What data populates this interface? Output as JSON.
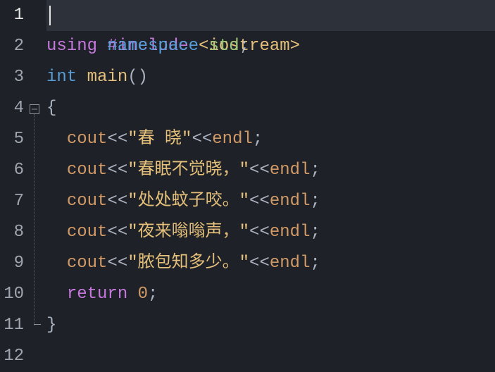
{
  "line_numbers": [
    "1",
    "2",
    "3",
    "4",
    "5",
    "6",
    "7",
    "8",
    "9",
    "10",
    "11",
    "12"
  ],
  "code": {
    "l1": {
      "pp": "#include",
      "sp": " ",
      "inc": "<iostream>"
    },
    "l2": {
      "kw": "using",
      "sp1": " ",
      "kw2": "namespace",
      "sp2": " ",
      "ns": "std",
      "semi": ";"
    },
    "l3": {
      "kw2": "int",
      "sp": " ",
      "fn": "main",
      "paren": "()"
    },
    "l4": {
      "brace": "{"
    },
    "l5": {
      "indent": "  ",
      "id1": "cout",
      "op1": "<<",
      "str": "\"春 晓\"",
      "op2": "<<",
      "id2": "endl",
      "semi": ";"
    },
    "l6": {
      "indent": "  ",
      "id1": "cout",
      "op1": "<<",
      "str": "\"春眠不觉晓，\"",
      "op2": "<<",
      "id2": "endl",
      "semi": ";"
    },
    "l7": {
      "indent": "  ",
      "id1": "cout",
      "op1": "<<",
      "str": "\"处处蚊子咬。\"",
      "op2": "<<",
      "id2": "endl",
      "semi": ";"
    },
    "l8": {
      "indent": "  ",
      "id1": "cout",
      "op1": "<<",
      "str": "\"夜来嗡嗡声，\"",
      "op2": "<<",
      "id2": "endl",
      "semi": ";"
    },
    "l9": {
      "indent": "  ",
      "id1": "cout",
      "op1": "<<",
      "str": "\"脓包知多少。\"",
      "op2": "<<",
      "id2": "endl",
      "semi": ";"
    },
    "l10": {
      "indent": "  ",
      "kw": "return",
      "sp": " ",
      "num": "0",
      "semi": ";"
    },
    "l11": {
      "brace": "}"
    }
  }
}
